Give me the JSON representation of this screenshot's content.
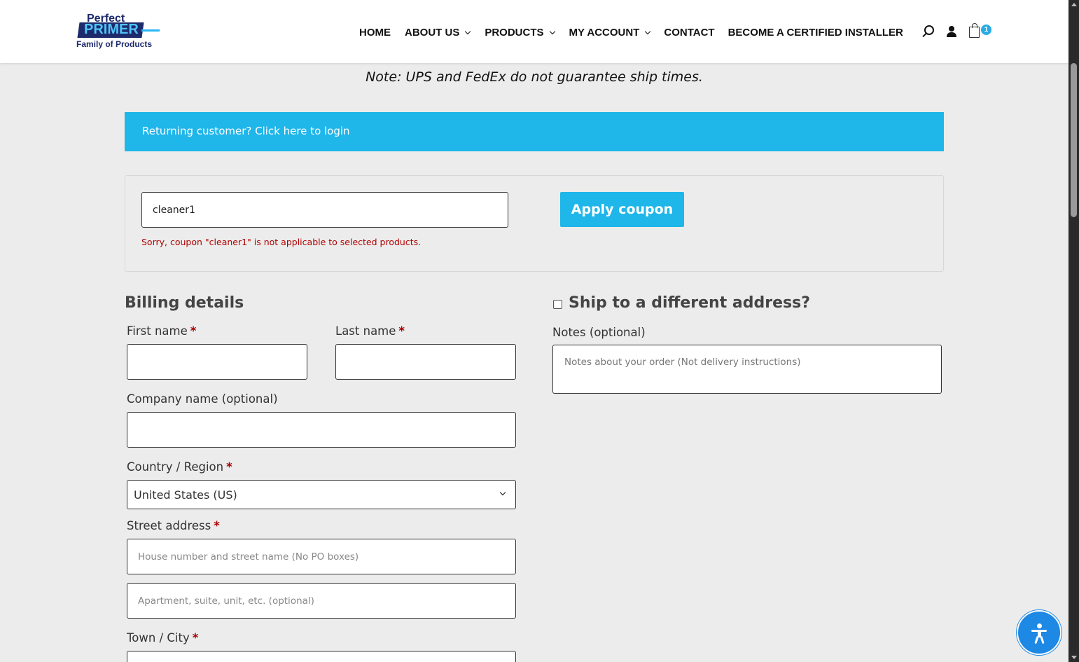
{
  "logo": {
    "line1": "Perfect",
    "line2": "PRIMER",
    "line3": "Family of Products"
  },
  "nav": {
    "items": [
      {
        "label": "HOME",
        "dropdown": false
      },
      {
        "label": "ABOUT US",
        "dropdown": true
      },
      {
        "label": "PRODUCTS",
        "dropdown": true
      },
      {
        "label": "MY ACCOUNT",
        "dropdown": true
      },
      {
        "label": "CONTACT",
        "dropdown": false
      },
      {
        "label": "BECOME A CERTIFIED INSTALLER",
        "dropdown": false
      }
    ],
    "cart_count": "1"
  },
  "shipping_note": "Note: UPS and FedEx do not guarantee ship times.",
  "login_banner": {
    "text": "Returning customer? Click here to login"
  },
  "coupon": {
    "value": "cleaner1",
    "button_label": "Apply coupon",
    "error": "Sorry, coupon \"cleaner1\" is not applicable to selected products."
  },
  "billing": {
    "title": "Billing details",
    "first_name_label": "First name",
    "last_name_label": "Last name",
    "company_label": "Company name (optional)",
    "country_label": "Country / Region",
    "country_value": "United States (US)",
    "street_label": "Street address",
    "street_placeholder": "House number and street name (No PO boxes)",
    "apartment_placeholder": "Apartment, suite, unit, etc. (optional)",
    "city_label": "Town / City",
    "required_mark": "*"
  },
  "shipping": {
    "title": "Ship to a different address?",
    "notes_label": "Notes (optional)",
    "notes_placeholder": "Notes about your order (Not delivery instructions)"
  },
  "colors": {
    "accent": "#1fb6ea",
    "brand_navy": "#1d2a6b",
    "error": "#b00000",
    "required": "#aa0000",
    "a11y": "#1e88e5"
  }
}
